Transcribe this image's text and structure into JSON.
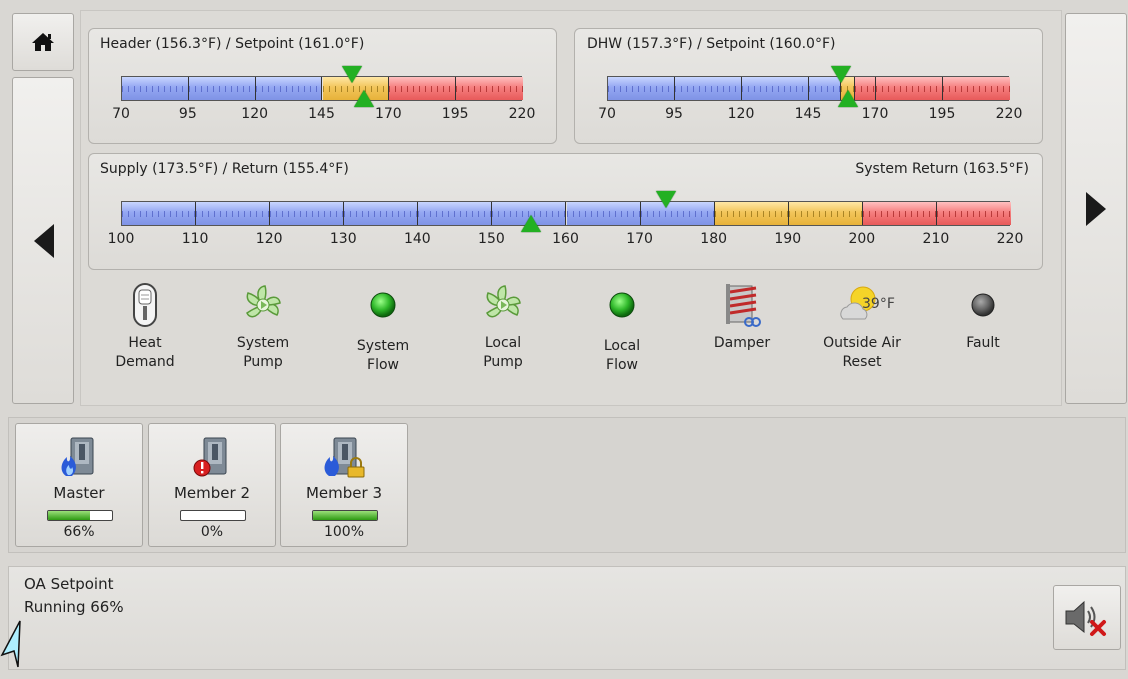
{
  "nav": {
    "home_icon": "home-icon",
    "left_icon": "left-arrow-icon",
    "right_icon": "right-arrow-icon"
  },
  "header_gauge": {
    "title": "Header (156.3°F) / Setpoint (161.0°F)",
    "ticks": [
      "70",
      "95",
      "120",
      "145",
      "170",
      "195",
      "220"
    ],
    "min": 70,
    "max": 220,
    "actual": 156.3,
    "setpoint": 161.0,
    "zones": [
      {
        "from": 70,
        "to": 145,
        "color": "blue"
      },
      {
        "from": 145,
        "to": 170,
        "color": "yellow"
      },
      {
        "from": 170,
        "to": 220,
        "color": "red"
      }
    ]
  },
  "dhw_gauge": {
    "title": "DHW (157.3°F) / Setpoint (160.0°F)",
    "ticks": [
      "70",
      "95",
      "120",
      "145",
      "170",
      "195",
      "220"
    ],
    "min": 70,
    "max": 220,
    "actual": 157.3,
    "setpoint": 160.0,
    "zones": [
      {
        "from": 70,
        "to": 157,
        "color": "blue"
      },
      {
        "from": 157,
        "to": 162,
        "color": "yellow"
      },
      {
        "from": 162,
        "to": 220,
        "color": "red"
      }
    ]
  },
  "supply_gauge": {
    "title_left": "Supply (173.5°F) / Return (155.4°F)",
    "title_right": "System Return (163.5°F)",
    "ticks": [
      "100",
      "110",
      "120",
      "130",
      "140",
      "150",
      "160",
      "170",
      "180",
      "190",
      "200",
      "210",
      "220"
    ],
    "min": 100,
    "max": 220,
    "supply": 173.5,
    "return": 155.4,
    "zones": [
      {
        "from": 100,
        "to": 180,
        "color": "blue"
      },
      {
        "from": 180,
        "to": 200,
        "color": "yellow"
      },
      {
        "from": 200,
        "to": 220,
        "color": "red"
      }
    ]
  },
  "status_icons": [
    {
      "name": "heat-demand",
      "label1": "Heat",
      "label2": "Demand",
      "icon": "switch-icon"
    },
    {
      "name": "system-pump",
      "label1": "System",
      "label2": "Pump",
      "icon": "pump-icon"
    },
    {
      "name": "system-flow",
      "label1": "System",
      "label2": "Flow",
      "icon": "green-led-icon"
    },
    {
      "name": "local-pump",
      "label1": "Local",
      "label2": "Pump",
      "icon": "pump-icon"
    },
    {
      "name": "local-flow",
      "label1": "Local",
      "label2": "Flow",
      "icon": "green-led-icon"
    },
    {
      "name": "damper",
      "label1": "Damper",
      "label2": "",
      "icon": "damper-icon"
    },
    {
      "name": "outside-air-reset",
      "label1": "Outside Air",
      "label2": "Reset",
      "icon": "weather-icon",
      "temp": "39°F"
    },
    {
      "name": "fault",
      "label1": "Fault",
      "label2": "",
      "icon": "gray-led-icon"
    }
  ],
  "boilers": [
    {
      "name": "Master",
      "percent": "66%",
      "level": 0.66,
      "badge": "flame"
    },
    {
      "name": "Member 2",
      "percent": "0%",
      "level": 0.0,
      "badge": "alarm"
    },
    {
      "name": "Member 3",
      "percent": "100%",
      "level": 1.0,
      "badge": "lock"
    }
  ],
  "status": {
    "line1": "OA Setpoint",
    "line2": "Running 66%"
  },
  "mute_icon": "speaker-mute-icon"
}
